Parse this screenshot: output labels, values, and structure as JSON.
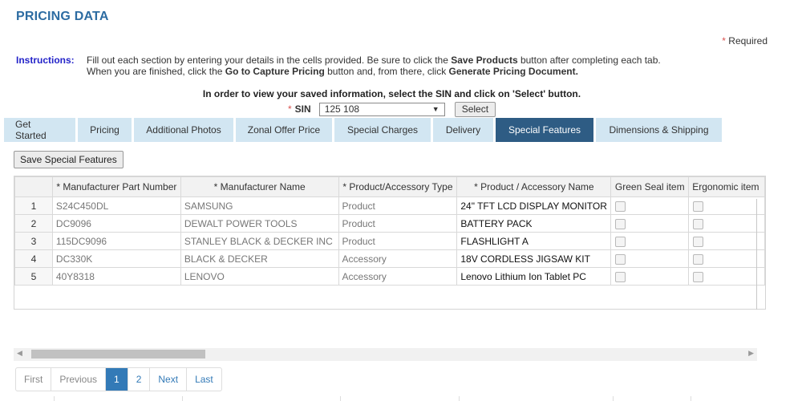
{
  "page": {
    "title": "PRICING DATA",
    "required_star": "*",
    "required_label": "Required"
  },
  "instructions": {
    "label": "Instructions:",
    "line1_a": "Fill out each section by entering your details in the cells provided. Be sure to click the ",
    "line1_b": "Save Products",
    "line1_c": " button after completing each tab.",
    "line2_a": "When you are finished, click the ",
    "line2_b": "Go to Capture Pricing",
    "line2_c": " button and, from there, click ",
    "line2_d": "Generate Pricing Document."
  },
  "sin": {
    "note": "In order to view your saved information, select the SIN and click on 'Select' button.",
    "star": "*",
    "label": "SIN",
    "selected": "125 108",
    "select_button": "Select"
  },
  "tabs": [
    {
      "label": "Get Started",
      "active": false
    },
    {
      "label": "Pricing",
      "active": false
    },
    {
      "label": "Additional Photos",
      "active": false
    },
    {
      "label": "Zonal Offer Price",
      "active": false
    },
    {
      "label": "Special Charges",
      "active": false
    },
    {
      "label": "Delivery",
      "active": false
    },
    {
      "label": "Special Features",
      "active": true
    },
    {
      "label": "Dimensions & Shipping",
      "active": false
    }
  ],
  "save_button": "Save Special Features",
  "table": {
    "columns": [
      "",
      "* Manufacturer Part Number",
      "* Manufacturer Name",
      "* Product/Accessory Type",
      "* Product / Accessory Name",
      "Green Seal item",
      "Ergonomic item"
    ],
    "rows": [
      {
        "n": "1",
        "part": "S24C450DL",
        "mfr": "SAMSUNG",
        "type": "Product",
        "name": "24\" TFT LCD DISPLAY MONITOR",
        "green": false,
        "ergo": false
      },
      {
        "n": "2",
        "part": "DC9096",
        "mfr": "DEWALT POWER TOOLS",
        "type": "Product",
        "name": "BATTERY PACK",
        "green": false,
        "ergo": false
      },
      {
        "n": "3",
        "part": "115DC9096",
        "mfr": "STANLEY BLACK & DECKER INC",
        "type": "Product",
        "name": "FLASHLIGHT A",
        "green": false,
        "ergo": false
      },
      {
        "n": "4",
        "part": "DC330K",
        "mfr": "BLACK & DECKER",
        "type": "Accessory",
        "name": "18V CORDLESS JIGSAW KIT",
        "green": false,
        "ergo": false
      },
      {
        "n": "5",
        "part": "40Y8318",
        "mfr": "LENOVO",
        "type": "Accessory",
        "name": "Lenovo Lithium Ion Tablet PC",
        "green": false,
        "ergo": false
      }
    ]
  },
  "pager": {
    "first": "First",
    "previous": "Previous",
    "pages": [
      "1",
      "2"
    ],
    "current": "1",
    "next": "Next",
    "last": "Last"
  },
  "icons": {
    "scroll_left": "triangle-left",
    "scroll_right": "triangle-right",
    "dropdown": "triangle-down"
  }
}
